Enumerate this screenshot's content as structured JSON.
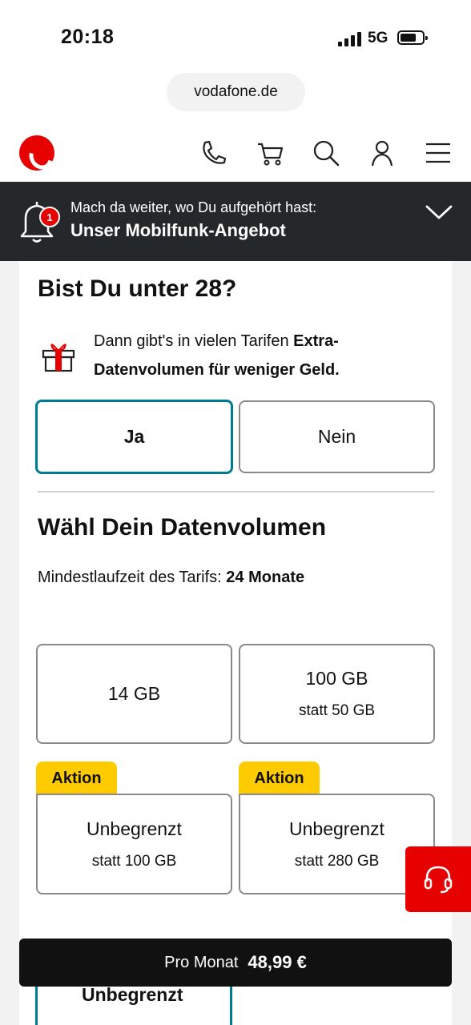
{
  "status": {
    "time": "20:18",
    "network": "5G"
  },
  "browser": {
    "url": "vodafone.de"
  },
  "header": {
    "icons": [
      "vodafone-logo",
      "phone-icon",
      "cart-icon",
      "search-icon",
      "user-icon",
      "menu-icon"
    ]
  },
  "reminder": {
    "badge_count": "1",
    "subtitle": "Mach da weiter, wo Du aufgehört hast:",
    "title": "Unser Mobilfunk-Angebot"
  },
  "age_section": {
    "heading": "Bist Du unter 28?",
    "promo_text": "Dann gibt's in vielen Tarifen ",
    "promo_bold": "Extra-Datenvolumen für weniger Geld.",
    "options": [
      {
        "label": "Ja",
        "selected": true
      },
      {
        "label": "Nein",
        "selected": false
      }
    ]
  },
  "data_section": {
    "heading": "Wähl Dein Datenvolumen",
    "min_term_label": "Mindestlaufzeit des Tarifs: ",
    "min_term_value": "24 Monate",
    "options": [
      {
        "main": "14 GB",
        "sub": "",
        "tag": ""
      },
      {
        "main": "100 GB",
        "sub": "statt 50 GB",
        "tag": ""
      },
      {
        "main": "Unbegrenzt",
        "sub": "statt 100 GB",
        "tag": "Aktion"
      },
      {
        "main": "Unbegrenzt",
        "sub": "statt 280 GB",
        "tag": "Aktion"
      }
    ],
    "partial_option": "Unbegrenzt"
  },
  "price_bar": {
    "label": "Pro Monat",
    "value": "48,99 €"
  },
  "colors": {
    "brand": "#e60000",
    "selected": "#007c92",
    "tag": "#fecb00",
    "dark": "#25282b"
  }
}
